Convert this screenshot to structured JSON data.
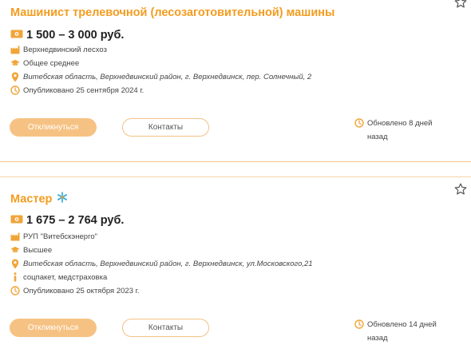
{
  "jobs": [
    {
      "title": "Машинист трелевочной (лесозаготовительной) машины",
      "salary": "1 500 – 3 000 руб.",
      "employer": "Верхнедвинский лесхоз",
      "education": "Общее среднее",
      "address": "Витебская область, Верхнедвинский район, г. Верхнедвинск, пер. Солнечный, 2",
      "published": "Опубликовано 25 сентября 2024 г.",
      "apply_label": "Откликнуться",
      "contacts_label": "Контакты",
      "updated_line1": "Обновлено 8 дней",
      "updated_line2": "назад"
    },
    {
      "title": "Мастер",
      "salary": "1 675 – 2 764 руб.",
      "employer": "РУП \"Витебскэнерго\"",
      "education": "Высшее",
      "address": "Витебская область, Верхнедвинский район, г. Верхнедвинск, ул.Московского,21",
      "benefits": "соцпакет, медстраховка",
      "published": "Опубликовано 25 октября 2023 г.",
      "apply_label": "Откликнуться",
      "contacts_label": "Контакты",
      "updated_line1": "Обновлено 14 дней",
      "updated_line2": "назад"
    }
  ],
  "icons": {
    "salary": "money-icon",
    "employer": "building-icon",
    "education": "graduation-cap-icon",
    "address": "location-pin-icon",
    "published": "clock-icon",
    "benefits": "info-icon",
    "favorite": "star-outline-icon",
    "featured": "sparkle-icon"
  },
  "colors": {
    "accent": "#f39c1f",
    "icon": "#f0a53a",
    "button_fill": "#f6c283",
    "separator": "#f2c98d"
  }
}
